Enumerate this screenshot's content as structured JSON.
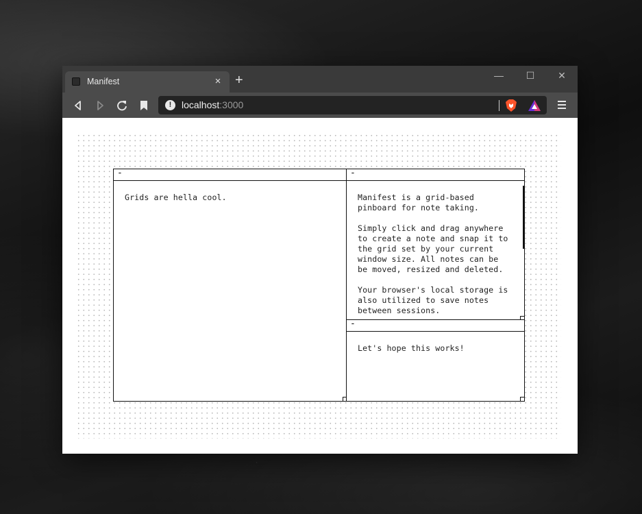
{
  "browser": {
    "tab": {
      "title": "Manifest",
      "close_label": "×"
    },
    "new_tab_label": "+",
    "window_controls": {
      "minimize": "—",
      "maximize": "☐",
      "close": "✕"
    },
    "address": {
      "host": "localhost",
      "port": ":3000"
    },
    "icons": [
      "back-icon",
      "forward-icon",
      "reload-icon",
      "bookmark-icon",
      "info-icon",
      "brave-shields-icon",
      "brave-rewards-icon",
      "menu-icon"
    ]
  },
  "notes": [
    {
      "minimize_label": "-",
      "text": "Grids are hella cool."
    },
    {
      "minimize_label": "-",
      "text": "Manifest is a grid-based\npinboard for note taking.\n\nSimply click and drag anywhere\nto create a note and snap it to\nthe grid set by your current\nwindow size. All notes can be\nbe moved, resized and deleted.\n\nYour browser's local storage is\nalso utilized to save notes\nbetween sessions."
    },
    {
      "minimize_label": "-",
      "text": "Let's hope this works!"
    }
  ],
  "colors": {
    "brave_orange": "#fb542b",
    "rewards_purple": "#6b2fd6"
  }
}
